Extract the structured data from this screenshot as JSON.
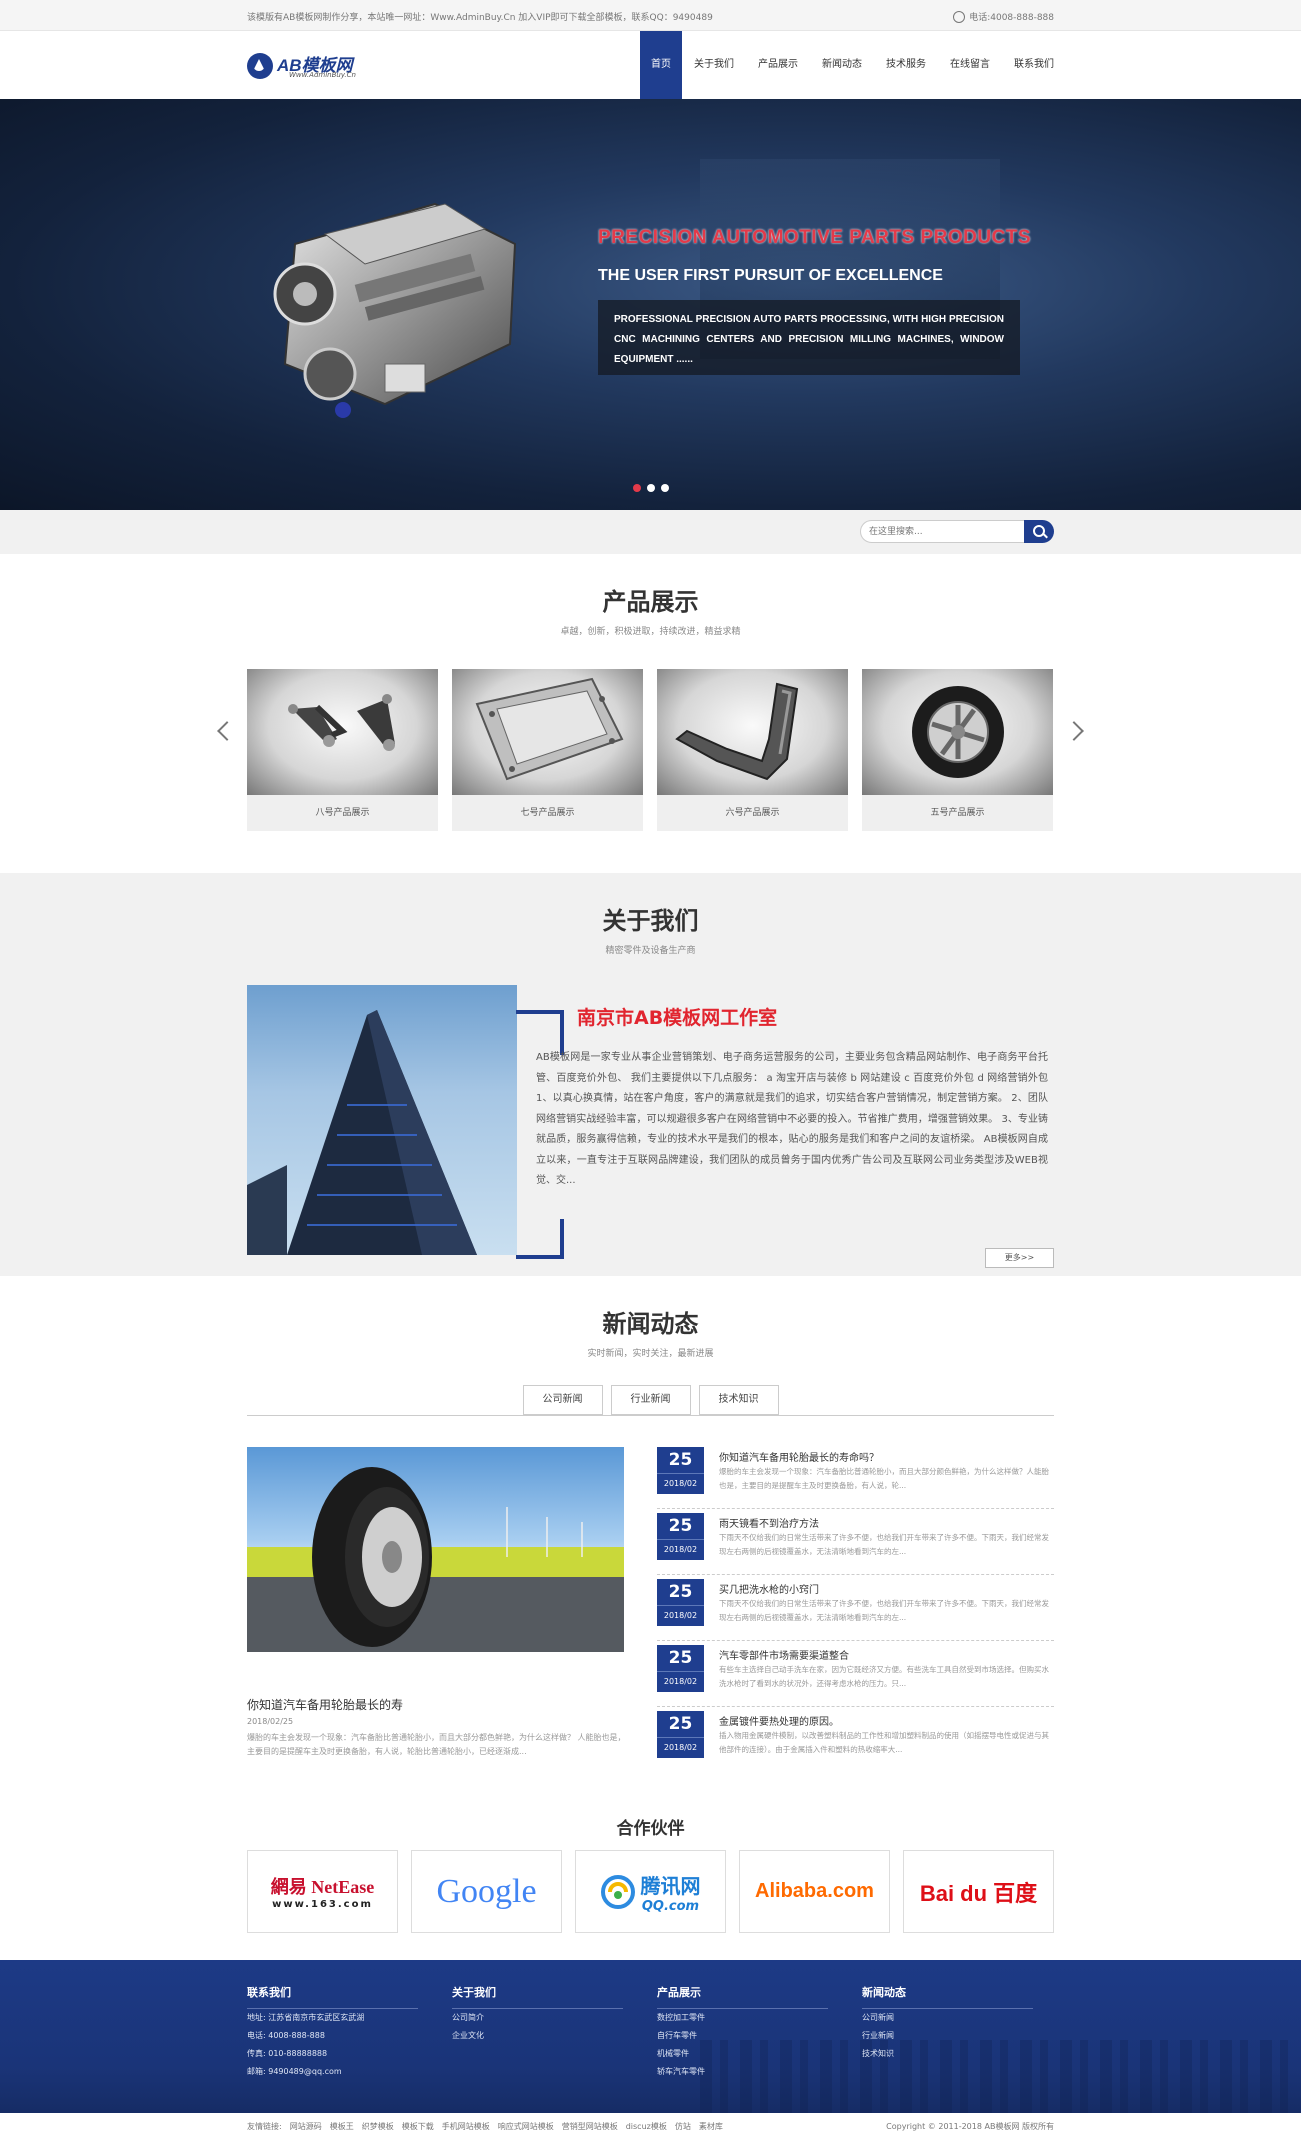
{
  "topbar": {
    "notice": "该模版有AB模板网制作分享，本站唯一网址：Www.AdminBuy.Cn 加入VIP即可下载全部模板，联系QQ：9490489",
    "phone": "电话:4008-888-888"
  },
  "logo": {
    "name": "AB模板网",
    "url": "Www.AdminBuy.Cn"
  },
  "nav": [
    "首页",
    "关于我们",
    "产品展示",
    "新闻动态",
    "技术服务",
    "在线留言",
    "联系我们"
  ],
  "banner": {
    "headline": "PRECISION AUTOMOTIVE PARTS PRODUCTS",
    "subheadline": "THE USER FIRST PURSUIT OF EXCELLENCE",
    "body": "PROFESSIONAL PRECISION AUTO PARTS PROCESSING, WITH HIGH PRECISION CNC MACHINING CENTERS AND PRECISION MILLING MACHINES, WINDOW EQUIPMENT ......",
    "active_slide": 1,
    "slide_count": 3
  },
  "search": {
    "placeholder": "在这里搜索..."
  },
  "products": {
    "title": "产品展示",
    "subtitle": "卓越，创新，积极进取，持续改进，精益求精",
    "items": [
      {
        "label": "八号产品展示",
        "icon": "control-arm"
      },
      {
        "label": "七号产品展示",
        "icon": "metal-frame"
      },
      {
        "label": "六号产品展示",
        "icon": "bracket-part"
      },
      {
        "label": "五号产品展示",
        "icon": "wheel"
      }
    ]
  },
  "about": {
    "title": "关于我们",
    "subtitle": "精密零件及设备生产商",
    "heading": "南京市AB模板网工作室",
    "text": "AB模板网是一家专业从事企业营销策划、电子商务运营服务的公司，主要业务包含精品网站制作、电子商务平台托管、百度竞价外包、 我们主要提供以下几点服务： a 淘宝开店与装修 b 网站建设 c 百度竞价外包 d 网络营销外包 1、以真心换真情，站在客户角度，客户的满意就是我们的追求，切实结合客户营销情况，制定营销方案。 2、团队网络营销实战经验丰富，可以规避很多客户在网络营销中不必要的投入。节省推广费用，增强营销效果。 3、专业铸就品质，服务赢得信赖，专业的技术水平是我们的根本，贴心的服务是我们和客户之间的友谊桥梁。 AB模板网自成立以来，一直专注于互联网品牌建设，我们团队的成员曾务于国内优秀广告公司及互联网公司业务类型涉及WEB视觉、交...",
    "more": "更多>>"
  },
  "news": {
    "title": "新闻动态",
    "subtitle": "实时新闻，实时关注，最新进展",
    "tabs": [
      "公司新闻",
      "行业新闻",
      "技术知识"
    ],
    "featured": {
      "title": "你知道汽车备用轮胎最长的寿",
      "date": "2018/02/25",
      "summary": "爆胎的车主会发现一个现象：汽车备胎比普通轮胎小，而且大部分都色鲜艳，为什么这样做？ 人能胎也是，主要目的是提醒车主及时更换备胎，有人说，轮胎比普通轮胎小，已经逐渐成..."
    },
    "items": [
      {
        "day": "25",
        "ym": "2018/02",
        "title": "你知道汽车备用轮胎最长的寿命吗？",
        "summary": "爆胎的车主会发现一个现象：汽车备胎比普通轮胎小，而且大部分颜色鲜艳，为什么这样做？人能胎也是，主要目的是提醒车主及时更换备胎，有人说，轮..."
      },
      {
        "day": "25",
        "ym": "2018/02",
        "title": "雨天镜看不到治疗方法",
        "summary": "下雨天不仅给我们的日常生活带来了许多不便，也给我们开车带来了许多不便。下雨天，我们经常发现左右两侧的后视镜覆盖水，无法清晰地看到汽车的左..."
      },
      {
        "day": "25",
        "ym": "2018/02",
        "title": "买几把洗水枪的小窍门",
        "summary": "下雨天不仅给我们的日常生活带来了许多不便，也给我们开车带来了许多不便。下雨天，我们经常发现左右两侧的后视镜覆盖水，无法清晰地看到汽车的左..."
      },
      {
        "day": "25",
        "ym": "2018/02",
        "title": "汽车零部件市场需要渠道整合",
        "summary": "有些车主选择自己动手洗车在家，因为它既经济又方便。有些洗车工具自然受到市场选择。但购买水洗水枪时了看到水的状况外，还得考虑水枪的压力。只..."
      },
      {
        "day": "25",
        "ym": "2018/02",
        "title": "金属镀件要热处理的原因。",
        "summary": "插入物用金属硬件模制，以改善塑料制品的工作性和增加塑料制品的使用（如摇摆导电性或促进与其他部件的连接）。由于金属插入件和塑料的热收缩率大..."
      }
    ]
  },
  "partners": {
    "title": "合作伙伴",
    "logos": [
      {
        "name": "網易 NetEase",
        "line2": "www.163.com",
        "color": "#c8102e"
      },
      {
        "name": "Google",
        "color": "#4285f4"
      },
      {
        "name": "腾讯网",
        "line2": "QQ.com",
        "color": "#1e7fd6"
      },
      {
        "name": "Alibaba.com",
        "color": "#ff6a00"
      },
      {
        "name": "Bai du 百度",
        "color": "#de0f17"
      }
    ]
  },
  "footer": {
    "cols": [
      {
        "title": "联系我们",
        "items": [
          "地址: 江苏省南京市玄武区玄武湖",
          "电话: 4008-888-888",
          "传真: 010-88888888",
          "邮箱: 9490489@qq.com"
        ]
      },
      {
        "title": "关于我们",
        "items": [
          "公司简介",
          "企业文化"
        ]
      },
      {
        "title": "产品展示",
        "items": [
          "数控加工零件",
          "自行车零件",
          "机械零件",
          "轿车汽车零件"
        ]
      },
      {
        "title": "新闻动态",
        "items": [
          "公司新闻",
          "行业新闻",
          "技术知识"
        ]
      }
    ]
  },
  "bottom": {
    "links_label": "友情链接:",
    "links": [
      "网站源码",
      "模板王",
      "织梦模板",
      "模板下载",
      "手机网站模板",
      "响应式网站模板",
      "营销型网站模板",
      "discuz模板",
      "仿站",
      "素材库"
    ],
    "copyright": "Copyright © 2011-2018 AB模板网 版权所有"
  },
  "colors": {
    "brand": "#1f3e8f",
    "accent_red": "#e1252f"
  }
}
